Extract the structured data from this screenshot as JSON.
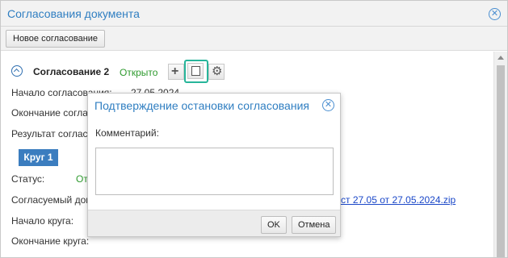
{
  "window": {
    "title": "Согласования документа"
  },
  "toolbar": {
    "new_approval_label": "Новое согласование"
  },
  "approval": {
    "title": "Согласование 2",
    "status": "Открыто",
    "rows": {
      "start_label": "Начало согласования:",
      "start_value": "27.05.2024",
      "end_label": "Окончание согласования:",
      "result_label": "Результат согласования:",
      "round_badge": "Круг 1",
      "status_label": "Статус:",
      "status_value": "Открыт",
      "document_label": "Согласуемый документ:",
      "document_link": "тест 27.05 от 27.05.2024.zip",
      "round_start_label": "Начало круга:",
      "round_end_label": "Окончание круга:"
    }
  },
  "dialog": {
    "title": "Подтверждение остановки согласования",
    "comment_label": "Комментарий:",
    "ok_label": "OK",
    "cancel_label": "Отмена"
  },
  "icons": {
    "close": "close-icon",
    "collapse": "chevron-up-icon",
    "add": "plus-icon",
    "stop": "stop-square-icon",
    "settings": "gear-icon"
  },
  "colors": {
    "accent": "#2f7ec1",
    "status_green": "#2e9a2e",
    "badge": "#3b7dbf",
    "focus": "#27b59a",
    "link": "#1a47c8"
  }
}
